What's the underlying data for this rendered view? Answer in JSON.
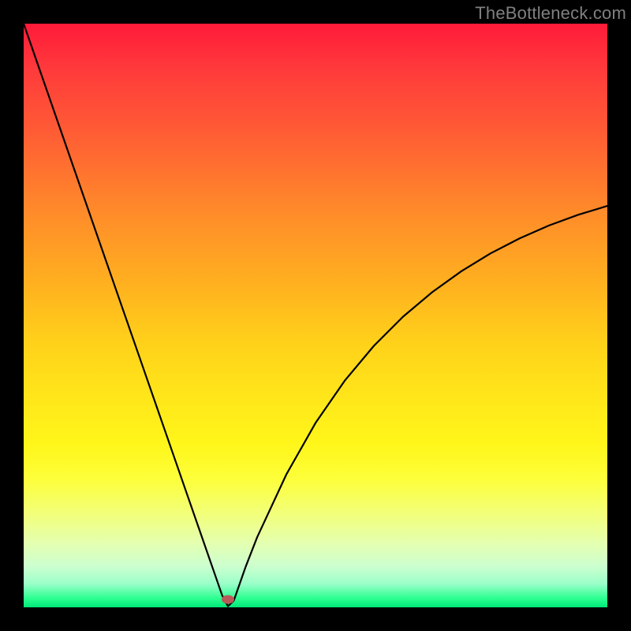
{
  "watermark": "TheBottleneck.com",
  "chart_data": {
    "type": "line",
    "title": "",
    "xlabel": "",
    "ylabel": "",
    "xlim": [
      0,
      100
    ],
    "ylim": [
      0,
      100
    ],
    "x": [
      0,
      5,
      10,
      15,
      20,
      25,
      28,
      30,
      32,
      33,
      34,
      35,
      36,
      38,
      40,
      45,
      50,
      55,
      60,
      65,
      70,
      75,
      80,
      85,
      90,
      95,
      100
    ],
    "values": [
      100,
      85.6,
      71.2,
      56.8,
      42.4,
      28.0,
      19.4,
      13.6,
      7.8,
      5.0,
      2.1,
      0.2,
      1.2,
      6.9,
      12.0,
      22.8,
      31.6,
      38.8,
      44.8,
      49.8,
      54.0,
      57.6,
      60.6,
      63.2,
      65.4,
      67.2,
      68.8
    ],
    "marker": {
      "x": 35,
      "y": 1.3
    },
    "gradient_colors": {
      "top": "#ff1a3a",
      "mid": "#ffe81a",
      "bottom": "#00e878"
    }
  }
}
